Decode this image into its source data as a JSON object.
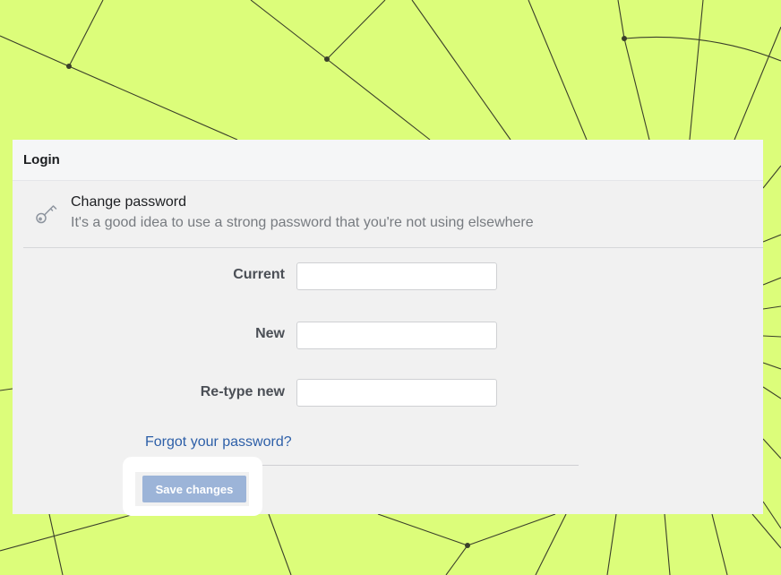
{
  "panel": {
    "title": "Login",
    "section": {
      "icon": "key-icon",
      "title": "Change password",
      "description": "It's a good idea to use a strong password that you're not using elsewhere"
    },
    "fields": [
      {
        "label": "Current",
        "value": ""
      },
      {
        "label": "New",
        "value": ""
      },
      {
        "label": "Re-type new",
        "value": ""
      }
    ],
    "forgot_link": "Forgot your password?",
    "save_label": "Save changes"
  },
  "colors": {
    "background": "#dcfd7a",
    "link": "#2d5fa8",
    "save_button": "#9cb4d8"
  }
}
